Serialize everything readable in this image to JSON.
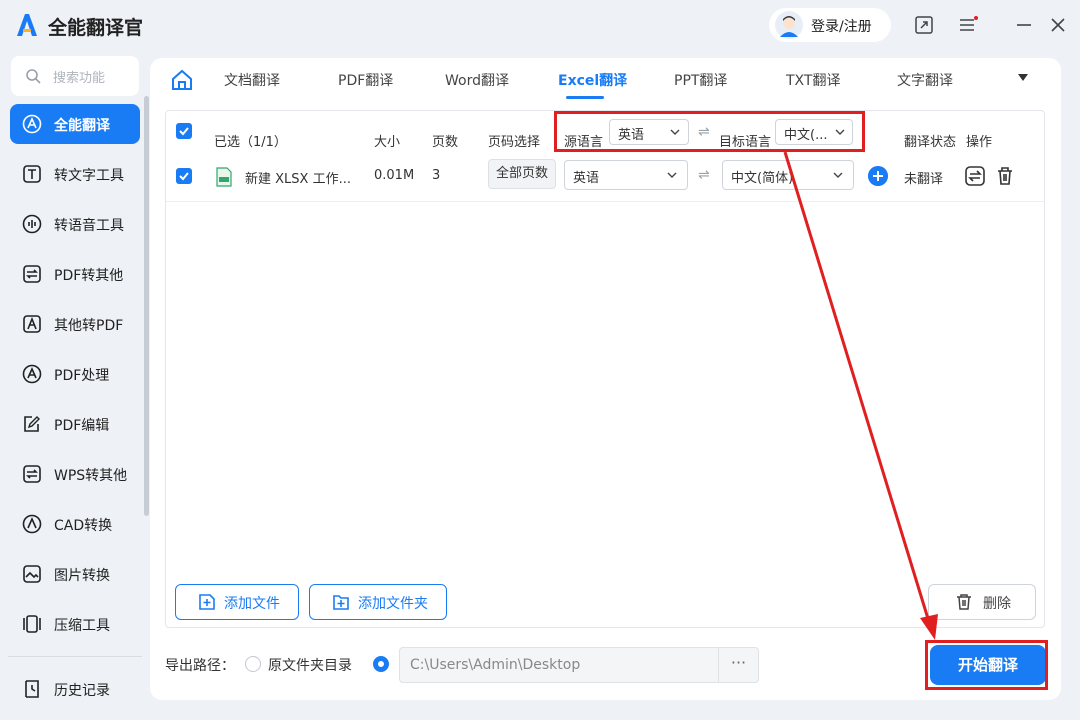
{
  "app": {
    "title": "全能翻译官"
  },
  "header": {
    "login_label": "登录/注册"
  },
  "sidebar": {
    "search_placeholder": "搜索功能",
    "items": [
      {
        "label": "全能翻译",
        "icon": "translate-icon"
      },
      {
        "label": "转文字工具",
        "icon": "text-icon"
      },
      {
        "label": "转语音工具",
        "icon": "audio-icon"
      },
      {
        "label": "PDF转其他",
        "icon": "pdf-convert-icon"
      },
      {
        "label": "其他转PDF",
        "icon": "to-pdf-icon"
      },
      {
        "label": "PDF处理",
        "icon": "pdf-process-icon"
      },
      {
        "label": "PDF编辑",
        "icon": "pdf-edit-icon"
      },
      {
        "label": "WPS转其他",
        "icon": "wps-icon"
      },
      {
        "label": "CAD转换",
        "icon": "cad-icon"
      },
      {
        "label": "图片转换",
        "icon": "image-icon"
      },
      {
        "label": "压缩工具",
        "icon": "compress-icon"
      }
    ],
    "history_label": "历史记录"
  },
  "tabs": [
    "文档翻译",
    "PDF翻译",
    "Word翻译",
    "Excel翻译",
    "PPT翻译",
    "TXT翻译",
    "文字翻译"
  ],
  "table": {
    "selected": "已选（1/1）",
    "col_size": "大小",
    "col_pages": "页数",
    "col_page_select": "页码选择",
    "source_lang_label": "源语言",
    "source_lang_value": "英语",
    "target_lang_label": "目标语言",
    "target_lang_value": "中文(...",
    "col_status": "翻译状态",
    "col_action": "操作",
    "row": {
      "filename": "新建 XLSX 工作...",
      "size": "0.01M",
      "pages": "3",
      "page_select": "全部页数",
      "source_lang": "英语",
      "target_lang": "中文(简体)",
      "status": "未翻译"
    }
  },
  "buttons": {
    "add_file": "添加文件",
    "add_folder": "添加文件夹",
    "delete": "删除",
    "start": "开始翻译",
    "more": "···"
  },
  "export": {
    "label": "导出路径：",
    "option_original": "原文件夹目录",
    "path": "C:\\Users\\Admin\\Desktop"
  },
  "colors": {
    "accent": "#1a7cf5",
    "highlight": "#e02020"
  }
}
